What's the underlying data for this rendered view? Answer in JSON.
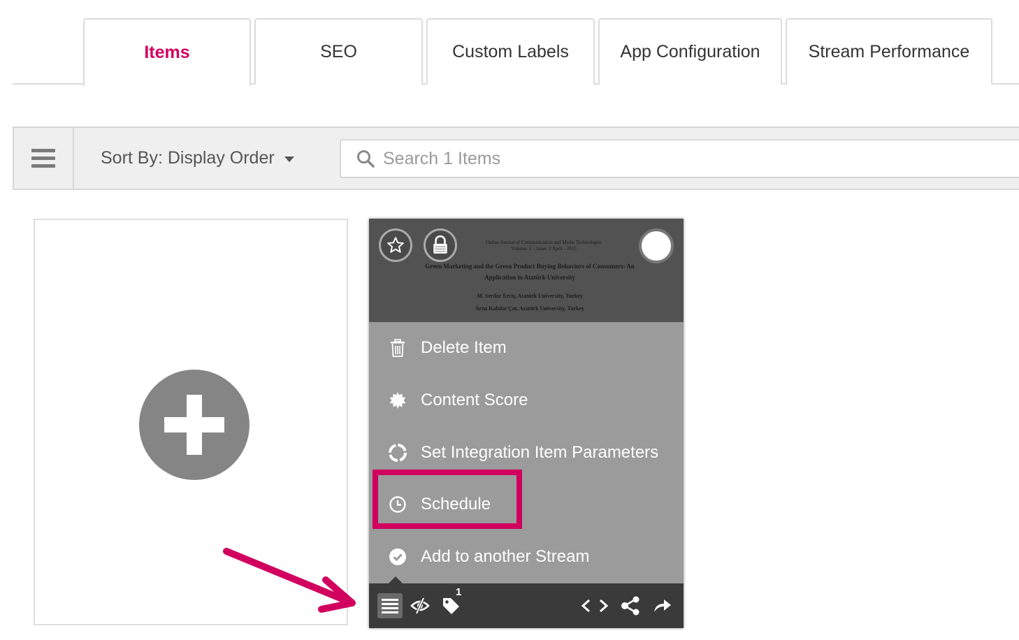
{
  "tabs": [
    {
      "label": "Items",
      "active": true
    },
    {
      "label": "SEO",
      "active": false
    },
    {
      "label": "Custom Labels",
      "active": false
    },
    {
      "label": "App Configuration",
      "active": false
    },
    {
      "label": "Stream Performance",
      "active": false
    }
  ],
  "toolbar": {
    "menu_icon": "hamburger-icon",
    "sort_label": "Sort By: Display Order",
    "search_placeholder": "Search 1 Items"
  },
  "add_card": {
    "icon": "plus-circle-icon"
  },
  "item_card": {
    "thumbnail": {
      "journal_line1": "Online Journal of Communication and Media Technologies",
      "journal_line2": "Volume: 5 – Issue: 2 April - 2015",
      "title_line1": "Green Marketing and the Green Product Buying Behaviors of Consumers: An",
      "title_line2": "Application in Atatürk University",
      "author1": "M. Serdar Erciş, Atatürk University, Turkey",
      "author2": "Arzu Kalafat Çat, Atatürk University, Turkey"
    },
    "menu": {
      "delete": "Delete Item",
      "content_score": "Content Score",
      "integration": "Set Integration Item Parameters",
      "schedule": "Schedule",
      "add_stream": "Add to another Stream"
    },
    "tag_count": "1"
  },
  "colors": {
    "accent": "#d1005f",
    "menu_bg": "#9b9b9b",
    "bar_bg": "#3a3a3a"
  }
}
